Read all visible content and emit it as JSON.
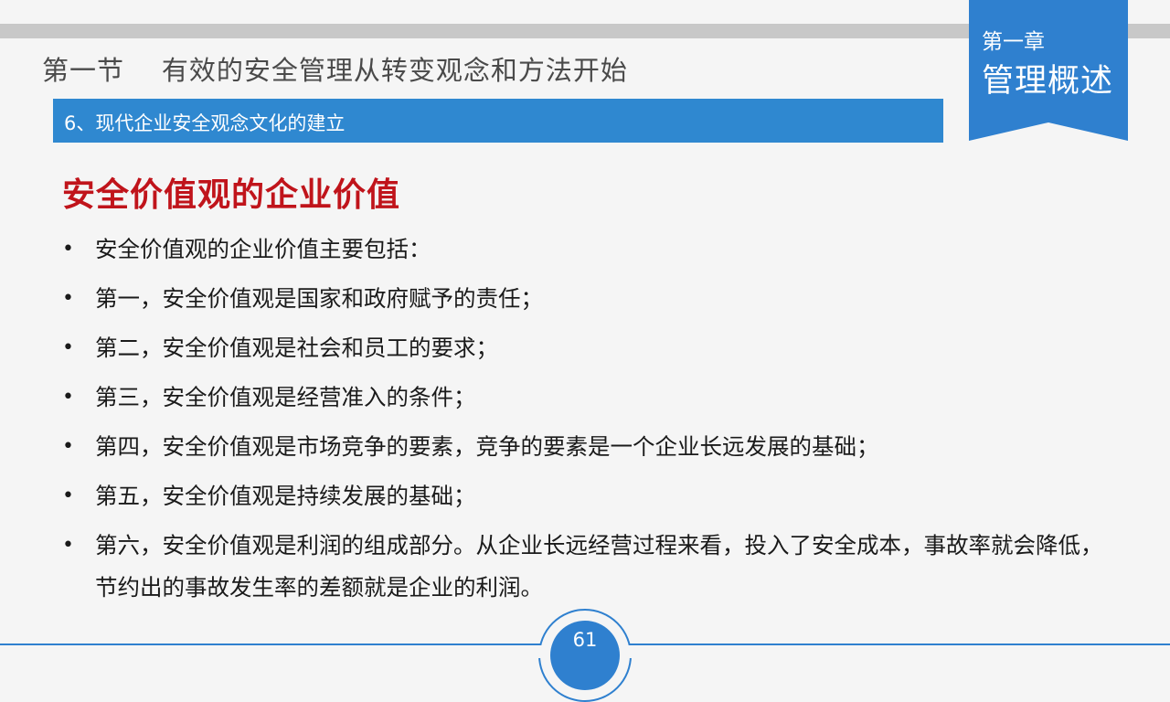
{
  "header": {
    "section_title": "第一节    有效的安全管理从转变观念和方法开始",
    "subtitle": "6、现代企业安全观念文化的建立"
  },
  "chapter": {
    "number": "第一章",
    "name": "管理概述"
  },
  "content": {
    "heading": "安全价值观的企业价值",
    "bullet_symbol": "•",
    "bullets": [
      "安全价值观的企业价值主要包括：",
      "第一，安全价值观是国家和政府赋予的责任；",
      "第二，安全价值观是社会和员工的要求；",
      "第三，安全价值观是经营准入的条件；",
      "第四，安全价值观是市场竞争的要素，竞争的要素是一个企业长远发展的基础；",
      "第五，安全价值观是持续发展的基础；",
      "第六，安全价值观是利润的组成部分。从企业长远经营过程来看，投入了安全成本，事故率就会降低，节约出的事故发生率的差额就是企业的利润。"
    ]
  },
  "footer": {
    "page_number": "61"
  },
  "colors": {
    "accent_blue": "#2f80cf",
    "heading_red": "#c0141b",
    "top_bar_gray": "#c8c8c8"
  }
}
